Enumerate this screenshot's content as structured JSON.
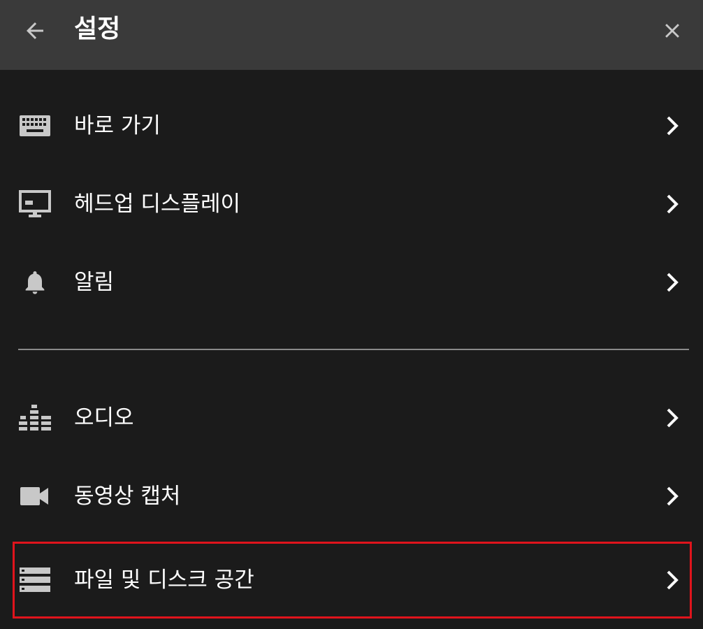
{
  "header": {
    "title": "설정",
    "back_icon": "arrow-left-icon",
    "close_icon": "close-icon"
  },
  "groups": [
    {
      "items": [
        {
          "label": "바로 가기",
          "icon": "keyboard-icon"
        },
        {
          "label": "헤드업 디스플레이",
          "icon": "monitor-icon"
        },
        {
          "label": "알림",
          "icon": "bell-icon"
        }
      ]
    },
    {
      "items": [
        {
          "label": "오디오",
          "icon": "equalizer-icon"
        },
        {
          "label": "동영상 캡처",
          "icon": "videocam-icon"
        },
        {
          "label": "파일 및 디스크 공간",
          "icon": "storage-icon",
          "highlighted": true
        }
      ]
    }
  ],
  "colors": {
    "header_bg": "#3a3a3a",
    "panel_bg": "#1b1b1b",
    "icon": "#c8c8c8",
    "highlight": "#e0141c",
    "divider": "#8a8a8a"
  }
}
